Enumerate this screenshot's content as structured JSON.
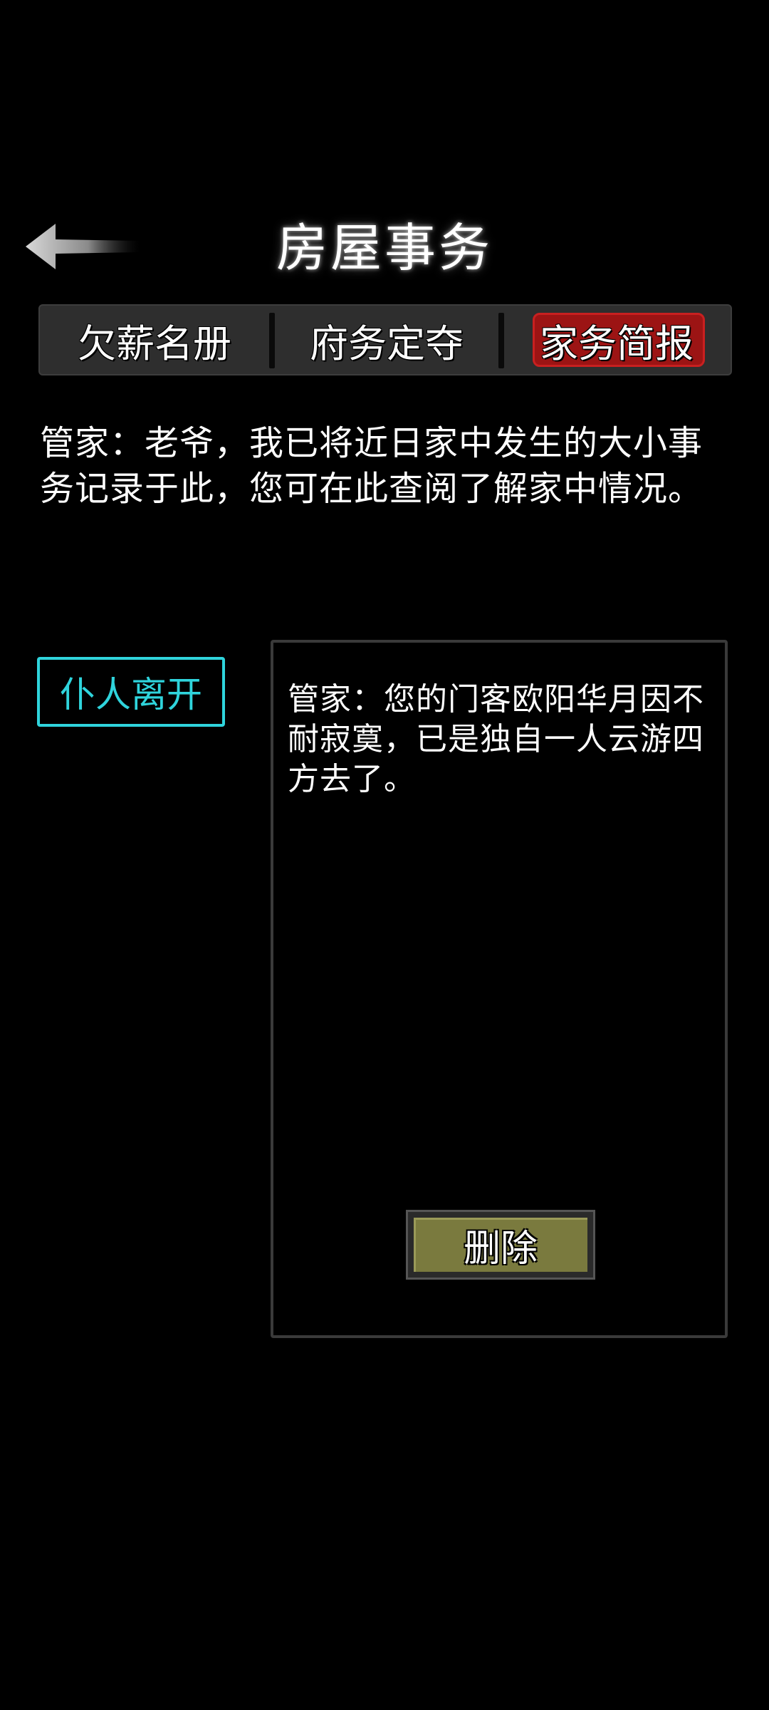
{
  "header": {
    "title": "房屋事务",
    "back_icon": "back-arrow-icon"
  },
  "tabs": [
    {
      "label": "欠薪名册",
      "active": false
    },
    {
      "label": "府务定夺",
      "active": false
    },
    {
      "label": "家务简报",
      "active": true
    }
  ],
  "colors": {
    "active_tab": "#9c1414",
    "category_accent": "#2fd4dc",
    "delete_button": "#7a7a3e"
  },
  "intro": {
    "text": "管家：老爷，我已将近日家中发生的大小事务记录于此，您可在此查阅了解家中情况。"
  },
  "category": {
    "label": "仆人离开"
  },
  "report": {
    "text": "管家：您的门客欧阳华月因不耐寂寞，已是独自一人云游四方去了。",
    "delete_label": "删除"
  }
}
